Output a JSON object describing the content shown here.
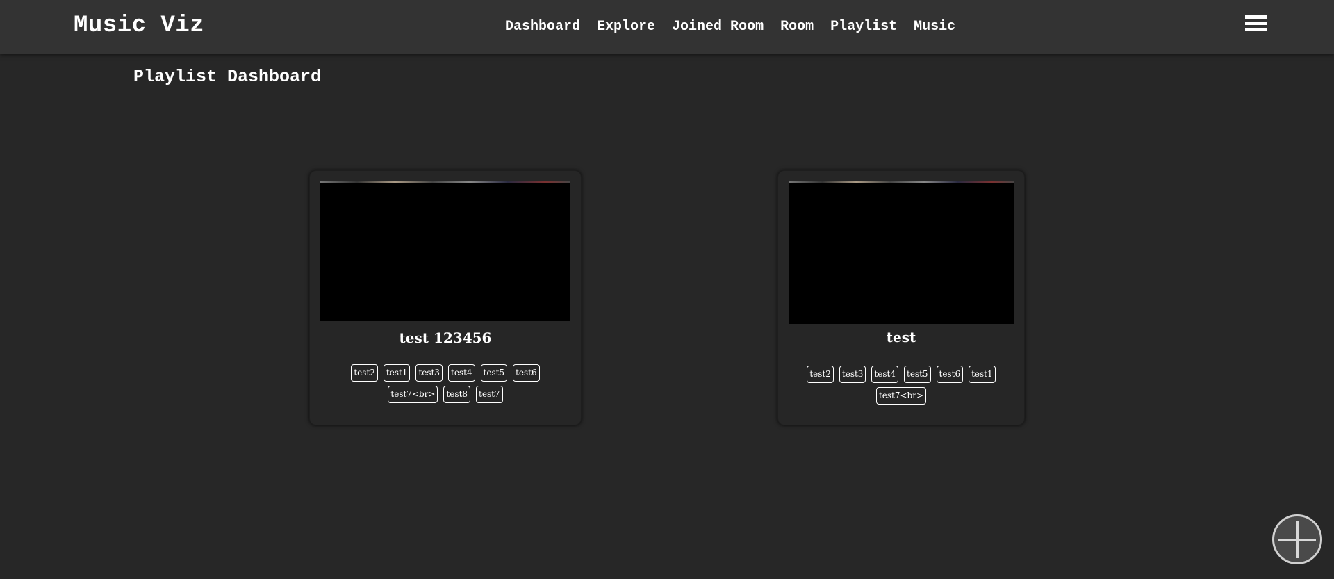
{
  "header": {
    "brand": "Music Viz",
    "nav": [
      "Dashboard",
      "Explore",
      "Joined Room",
      "Room",
      "Playlist",
      "Music"
    ],
    "menu_icon": "hamburger-menu-icon"
  },
  "page": {
    "title": "Playlist Dashboard"
  },
  "playlists": [
    {
      "title": "test 123456",
      "tags": [
        "test2",
        "test1",
        "test3",
        "test4",
        "test5",
        "test6",
        "test7<br>",
        "test8",
        "test7"
      ]
    },
    {
      "title": "test",
      "tags": [
        "test2",
        "test3",
        "test4",
        "test5",
        "test6",
        "test1",
        "test7<br>"
      ]
    }
  ],
  "fab": {
    "icon": "plus-circle-icon"
  },
  "colors": {
    "background": "#272727",
    "header": "#333333",
    "card": "#262626",
    "text": "#ffffff"
  }
}
